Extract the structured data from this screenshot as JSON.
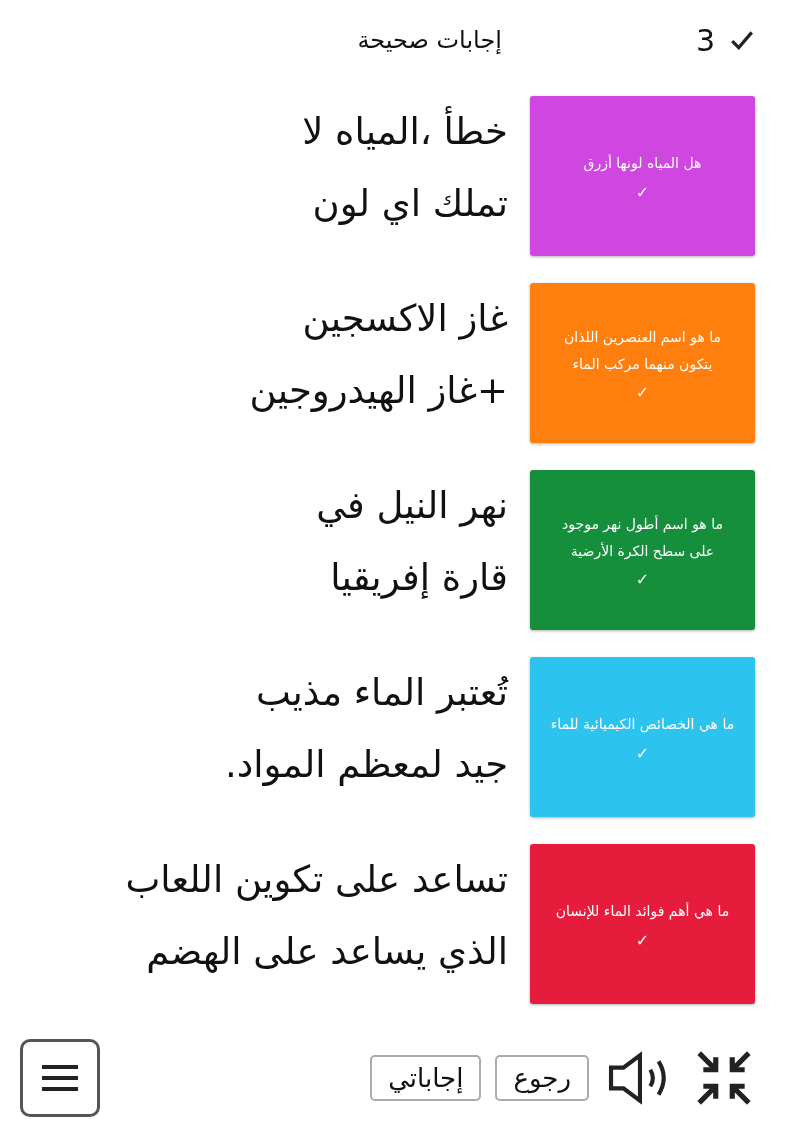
{
  "header": {
    "title": "إجابات صحيحة",
    "score": "3"
  },
  "items": [
    {
      "question": "هل المياه لونها أزرق",
      "mark": "✓",
      "color": "#d046e0",
      "answer_lines": [
        "خطأ ،المياه لا",
        "تملك اي لون"
      ]
    },
    {
      "question": "ما هو اسم العنصرين اللذان يتكون منهما مركب الماء",
      "mark": "✓",
      "color": "#ff7f0e",
      "answer_lines": [
        "غاز الاكسجين",
        "+غاز الهيدروجين"
      ]
    },
    {
      "question": "ما هو اسم أطول نهر موجود على سطح الكرة الأرضية",
      "mark": "✓",
      "color": "#168f3c",
      "answer_lines": [
        "نهر النيل في",
        "قارة إفريقيا"
      ]
    },
    {
      "question": "ما هي الخصائص الكيميائية للماء",
      "mark": "✓",
      "color": "#2cc3ef",
      "answer_lines": [
        "تُعتبر الماء مذيب",
        "جيد لمعظم المواد."
      ]
    },
    {
      "question": "ما هي أهم فوائد الماء للإنسان",
      "mark": "✓",
      "color": "#e51c3c",
      "answer_lines": [
        "تساعد على تكوين اللعاب",
        "الذي يساعد على الهضم"
      ]
    }
  ],
  "footer": {
    "buttons": [
      "رجوع",
      "إجاباتي"
    ]
  }
}
